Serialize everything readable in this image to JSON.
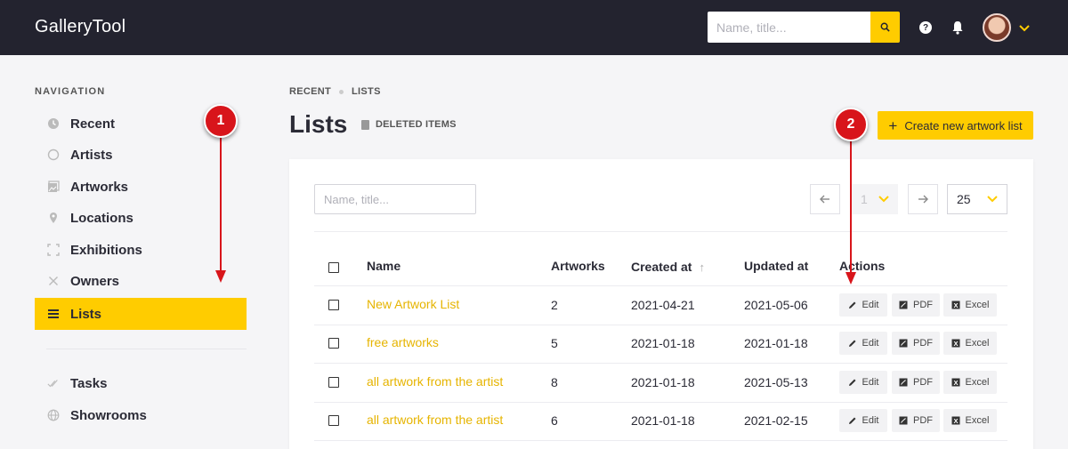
{
  "app": {
    "title": "GalleryTool"
  },
  "topbar": {
    "search_placeholder": "Name, title...",
    "help": "?"
  },
  "nav": {
    "title": "NAVIGATION",
    "items": [
      {
        "label": "Recent",
        "icon": "clock-icon"
      },
      {
        "label": "Artists",
        "icon": "circle-icon"
      },
      {
        "label": "Artworks",
        "icon": "image-icon"
      },
      {
        "label": "Locations",
        "icon": "pin-icon"
      },
      {
        "label": "Exhibitions",
        "icon": "frame-icon"
      },
      {
        "label": "Owners",
        "icon": "x-icon"
      },
      {
        "label": "Lists",
        "icon": "list-icon",
        "active": true
      }
    ],
    "secondary": [
      {
        "label": "Tasks",
        "icon": "check-icon"
      },
      {
        "label": "Showrooms",
        "icon": "globe-icon"
      }
    ]
  },
  "breadcrumb": [
    "RECENT",
    "LISTS"
  ],
  "page": {
    "title": "Lists",
    "deleted_label": "DELETED ITEMS",
    "create_label": "Create new artwork list"
  },
  "filter": {
    "placeholder": "Name, title...",
    "page": "1",
    "per_page": "25"
  },
  "table": {
    "columns": [
      "Name",
      "Artworks",
      "Created at",
      "Updated at",
      "Actions"
    ],
    "rows": [
      {
        "name": "New Artwork List",
        "artworks": "2",
        "created": "2021-04-21",
        "updated": "2021-05-06"
      },
      {
        "name": "free artworks",
        "artworks": "5",
        "created": "2021-01-18",
        "updated": "2021-01-18"
      },
      {
        "name": "all artwork from the artist",
        "artworks": "8",
        "created": "2021-01-18",
        "updated": "2021-05-13"
      },
      {
        "name": "all artwork from the artist",
        "artworks": "6",
        "created": "2021-01-18",
        "updated": "2021-02-15"
      }
    ],
    "actions": {
      "edit": "Edit",
      "pdf": "PDF",
      "excel": "Excel",
      "excel_glyph": "X"
    }
  },
  "annotations": {
    "marker1": "1",
    "marker2": "2"
  },
  "colors": {
    "accent": "#ffcc00",
    "topbar": "#23232f",
    "link": "#e6b400",
    "marker": "#d8151b"
  }
}
